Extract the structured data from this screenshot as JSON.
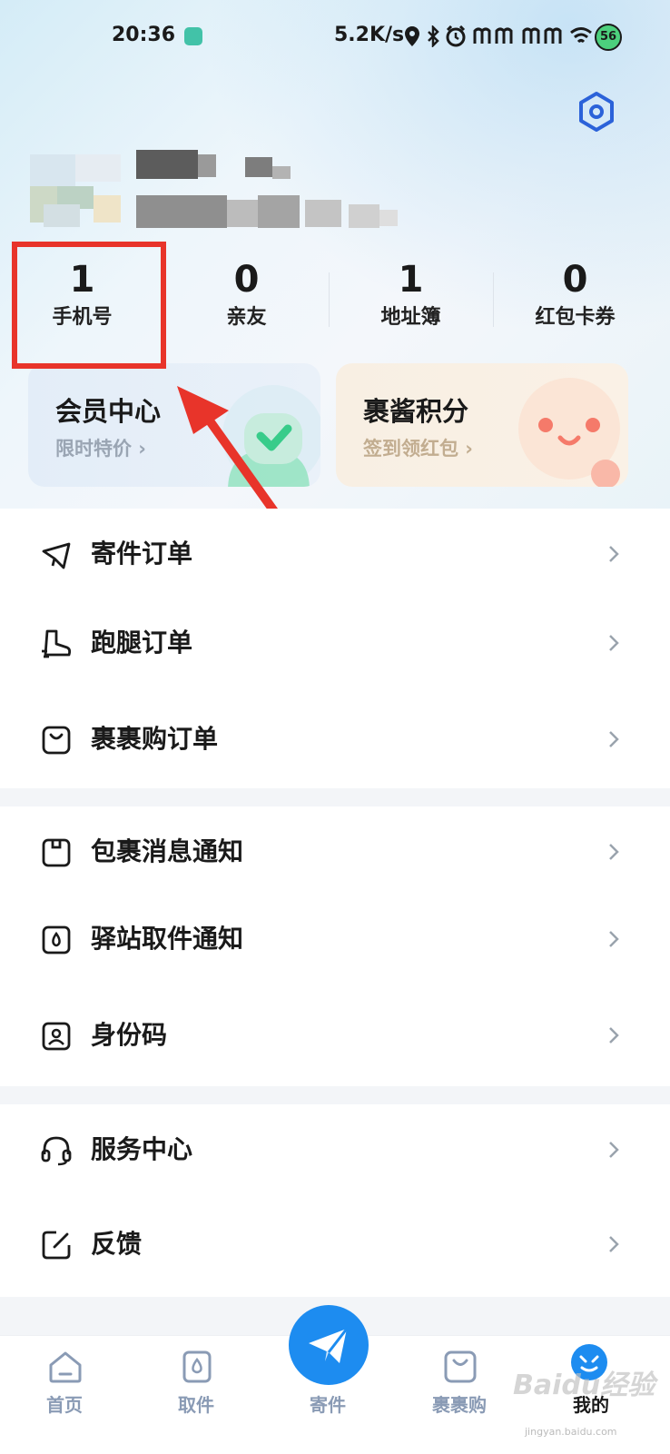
{
  "status_bar": {
    "time": "20:36",
    "network_speed": "5.2K/s",
    "battery": "56"
  },
  "stats": [
    {
      "value": "1",
      "label": "手机号"
    },
    {
      "value": "0",
      "label": "亲友"
    },
    {
      "value": "1",
      "label": "地址簿"
    },
    {
      "value": "0",
      "label": "红包卡券"
    }
  ],
  "cards": {
    "member": {
      "title": "会员中心",
      "subtitle": "限时特价 ›"
    },
    "points": {
      "title": "裹酱积分",
      "subtitle": "签到领红包 ›"
    }
  },
  "menu": {
    "orders": [
      {
        "label": "寄件订单",
        "icon": "send-icon"
      },
      {
        "label": "跑腿订单",
        "icon": "shoe-icon"
      },
      {
        "label": "裹裹购订单",
        "icon": "shopping-bag-icon"
      }
    ],
    "notifications": [
      {
        "label": "包裹消息通知",
        "icon": "package-icon"
      },
      {
        "label": "驿站取件通知",
        "icon": "station-icon"
      },
      {
        "label": "身份码",
        "icon": "id-code-icon"
      }
    ],
    "service": [
      {
        "label": "服务中心",
        "icon": "headset-icon"
      },
      {
        "label": "反馈",
        "icon": "edit-icon"
      }
    ]
  },
  "tab_bar": {
    "tabs": [
      {
        "label": "首页",
        "icon": "home-icon"
      },
      {
        "label": "取件",
        "icon": "pickup-icon"
      },
      {
        "label": "寄件",
        "icon": "paper-plane-icon"
      },
      {
        "label": "裹裹购",
        "icon": "shopping-bag-icon"
      },
      {
        "label": "我的",
        "icon": "profile-icon"
      }
    ],
    "active": "我的"
  },
  "colors": {
    "accent": "#1d8cf0",
    "highlight_box": "#e8342a",
    "tab_inactive": "#8a9bb5"
  },
  "watermark": {
    "text": "Baidu经验",
    "sub": "jingyan.baidu.com"
  }
}
